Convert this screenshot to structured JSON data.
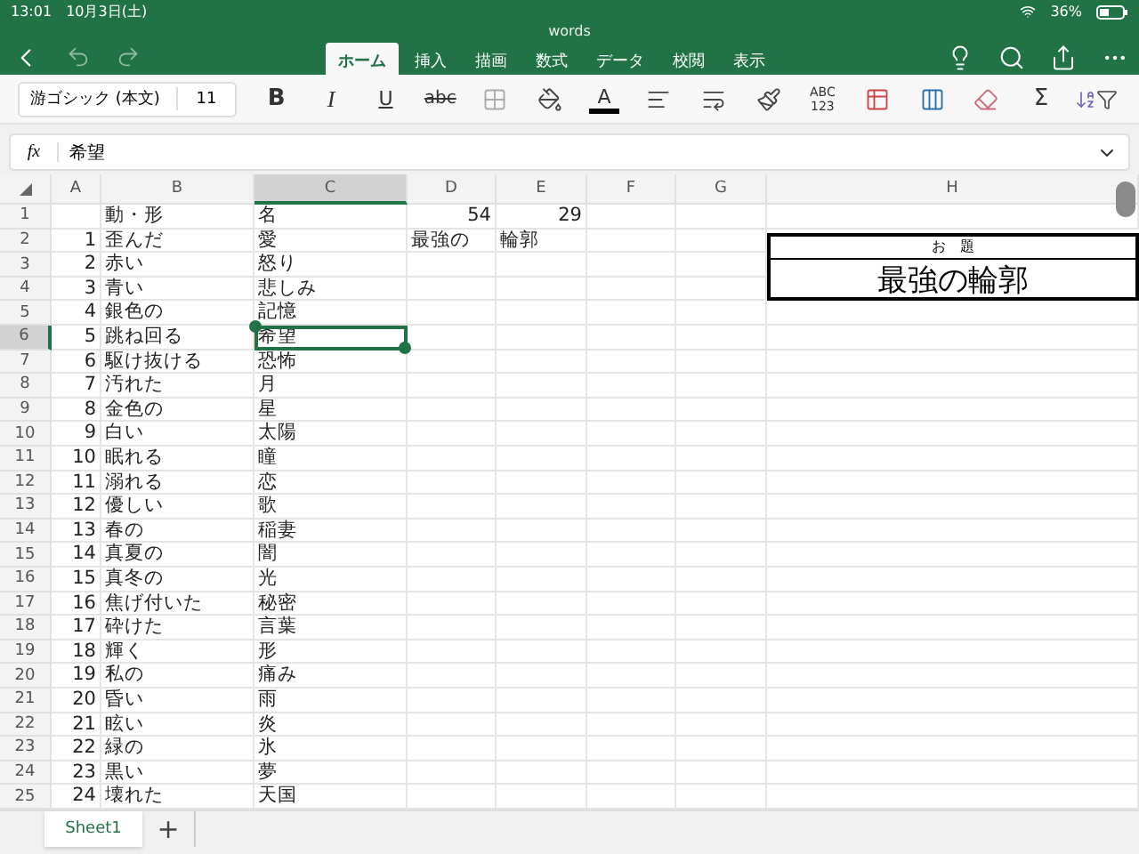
{
  "status_bar": {
    "time": "13:01",
    "date": "10月3日(土)",
    "battery": "36%"
  },
  "window": {
    "title": "words"
  },
  "tabs": [
    {
      "label": "ホーム",
      "selected": true
    },
    {
      "label": "挿入",
      "selected": false
    },
    {
      "label": "描画",
      "selected": false
    },
    {
      "label": "数式",
      "selected": false
    },
    {
      "label": "データ",
      "selected": false
    },
    {
      "label": "校閲",
      "selected": false
    },
    {
      "label": "表示",
      "selected": false
    }
  ],
  "ribbon": {
    "font_name": "游ゴシック (本文)",
    "font_size": "11",
    "items": [
      {
        "kind": "bold",
        "label": "B"
      },
      {
        "kind": "italic",
        "label": "I"
      },
      {
        "kind": "underline",
        "label": "U"
      },
      {
        "kind": "strike",
        "label": "abc"
      },
      {
        "kind": "borders"
      },
      {
        "kind": "fill"
      },
      {
        "kind": "font-color",
        "label": "A"
      },
      {
        "kind": "align"
      },
      {
        "kind": "wrap"
      },
      {
        "kind": "format"
      },
      {
        "kind": "number-format",
        "lines": [
          "ABC",
          "123"
        ]
      },
      {
        "kind": "insert-delete"
      },
      {
        "kind": "autofit"
      },
      {
        "kind": "clear"
      },
      {
        "kind": "sum",
        "label": "Σ"
      },
      {
        "kind": "sort-filter"
      }
    ]
  },
  "formula_bar": {
    "label": "fx",
    "value": "希望"
  },
  "columns": [
    {
      "label": "A",
      "selected": false
    },
    {
      "label": "B",
      "selected": false
    },
    {
      "label": "C",
      "selected": true
    },
    {
      "label": "D",
      "selected": false
    },
    {
      "label": "E",
      "selected": false
    },
    {
      "label": "F",
      "selected": false
    },
    {
      "label": "G",
      "selected": false
    },
    {
      "label": "H",
      "selected": false
    }
  ],
  "rows": [
    {
      "label": "1",
      "selected": false,
      "b": "動・形",
      "c": "名",
      "d": "54",
      "e": "29"
    },
    {
      "label": "2",
      "selected": false,
      "a": "1",
      "b": "歪んだ",
      "c": "愛",
      "d": "最強の",
      "e": "輪郭"
    },
    {
      "label": "3",
      "selected": false,
      "a": "2",
      "b": "赤い",
      "c": "怒り"
    },
    {
      "label": "4",
      "selected": false,
      "a": "3",
      "b": "青い",
      "c": "悲しみ"
    },
    {
      "label": "5",
      "selected": false,
      "a": "4",
      "b": "銀色の",
      "c": "記憶"
    },
    {
      "label": "6",
      "selected": true,
      "a": "5",
      "b": "跳ね回る",
      "c": "希望"
    },
    {
      "label": "7",
      "selected": false,
      "a": "6",
      "b": "駆け抜ける",
      "c": "恐怖"
    },
    {
      "label": "8",
      "selected": false,
      "a": "7",
      "b": "汚れた",
      "c": "月"
    },
    {
      "label": "9",
      "selected": false,
      "a": "8",
      "b": "金色の",
      "c": "星"
    },
    {
      "label": "10",
      "selected": false,
      "a": "9",
      "b": "白い",
      "c": "太陽"
    },
    {
      "label": "11",
      "selected": false,
      "a": "10",
      "b": "眠れる",
      "c": "瞳"
    },
    {
      "label": "12",
      "selected": false,
      "a": "11",
      "b": "溺れる",
      "c": "恋"
    },
    {
      "label": "13",
      "selected": false,
      "a": "12",
      "b": "優しい",
      "c": "歌"
    },
    {
      "label": "14",
      "selected": false,
      "a": "13",
      "b": "春の",
      "c": "稲妻"
    },
    {
      "label": "15",
      "selected": false,
      "a": "14",
      "b": "真夏の",
      "c": "闇"
    },
    {
      "label": "16",
      "selected": false,
      "a": "15",
      "b": "真冬の",
      "c": "光"
    },
    {
      "label": "17",
      "selected": false,
      "a": "16",
      "b": "焦げ付いた",
      "c": "秘密"
    },
    {
      "label": "18",
      "selected": false,
      "a": "17",
      "b": "砕けた",
      "c": "言葉"
    },
    {
      "label": "19",
      "selected": false,
      "a": "18",
      "b": "輝く",
      "c": "形"
    },
    {
      "label": "20",
      "selected": false,
      "a": "19",
      "b": "私の",
      "c": "痛み"
    },
    {
      "label": "21",
      "selected": false,
      "a": "20",
      "b": "昏い",
      "c": "雨"
    },
    {
      "label": "22",
      "selected": false,
      "a": "21",
      "b": "眩い",
      "c": "炎"
    },
    {
      "label": "23",
      "selected": false,
      "a": "22",
      "b": "緑の",
      "c": "氷"
    },
    {
      "label": "24",
      "selected": false,
      "a": "23",
      "b": "黒い",
      "c": "夢"
    },
    {
      "label": "25",
      "selected": false,
      "a": "24",
      "b": "壊れた",
      "c": "天国"
    }
  ],
  "title_box": {
    "caption": "お　題",
    "text": "最強の輪郭"
  },
  "sheet_tabs": [
    {
      "label": "Sheet1",
      "selected": true
    }
  ],
  "add_sheet": "+"
}
